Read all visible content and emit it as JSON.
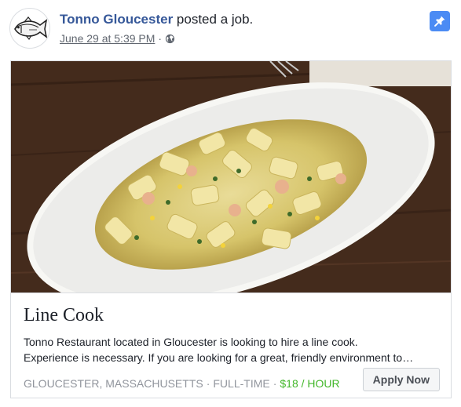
{
  "post": {
    "page_name": "Tonno Gloucester",
    "action_text": " posted a job.",
    "timestamp": "June 29 at 5:39 PM",
    "separator": "·",
    "audience_icon": "globe-icon",
    "pin_icon": "pushpin-icon",
    "colors": {
      "page_name": "#365899",
      "pin_background": "#4b8bf4",
      "salary": "#42b72a"
    }
  },
  "job": {
    "title": "Line Cook",
    "description_line1": "Tonno Restaurant located in Gloucester is looking to hire a line cook.",
    "description_line2": "Experience is necessary. If you are looking for a great, friendly environment to…",
    "location": "GLOUCESTER, MASSACHUSETTS",
    "type": "FULL-TIME",
    "salary": "$18 / HOUR",
    "meta_separator": "·",
    "apply_label": "Apply Now"
  }
}
